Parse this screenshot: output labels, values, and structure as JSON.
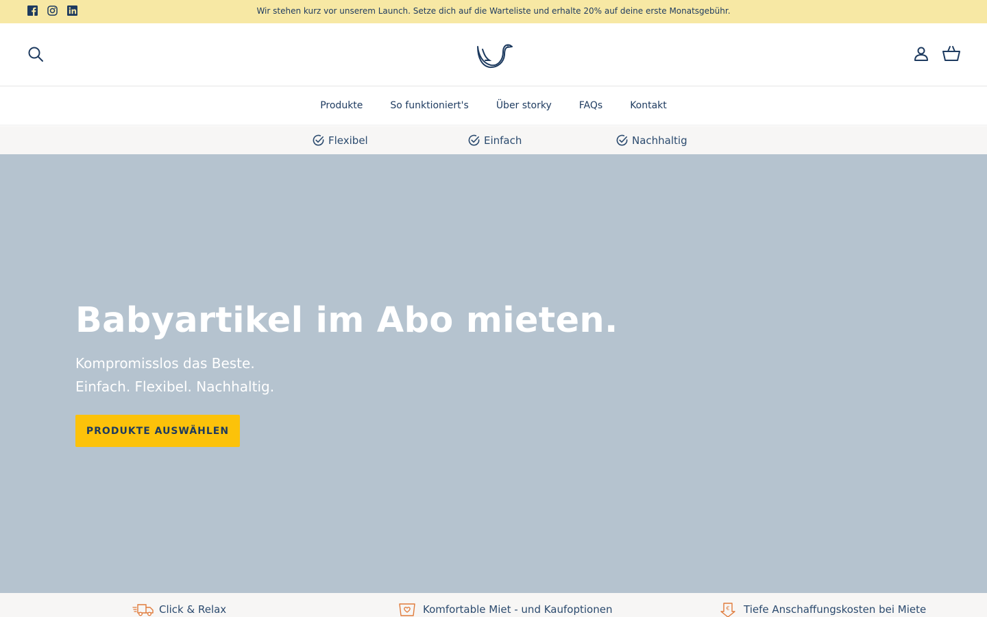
{
  "announcement": {
    "text": "Wir stehen kurz vor unserem Launch. Setze dich auf die Warteliste und erhalte 20% auf deine erste Monatsgebühr.",
    "background": "#f7e8a4",
    "social_icons": [
      "facebook-icon",
      "instagram-icon",
      "linkedin-icon"
    ]
  },
  "header": {
    "icons": [
      "search-icon",
      "logo-stork",
      "account-icon",
      "cart-icon"
    ]
  },
  "nav": {
    "items": [
      {
        "label": "Produkte"
      },
      {
        "label": "So funktioniert's"
      },
      {
        "label": "Über storky"
      },
      {
        "label": "FAQs"
      },
      {
        "label": "Kontakt"
      }
    ]
  },
  "usps": [
    {
      "label": "Flexibel",
      "icon": "check-circle-icon"
    },
    {
      "label": "Einfach",
      "icon": "check-circle-icon"
    },
    {
      "label": "Nachhaltig",
      "icon": "check-circle-icon"
    }
  ],
  "hero": {
    "title": "Babyartikel im Abo mieten.",
    "subtitle_line1": "Kompromisslos das Beste.",
    "subtitle_line2": "Einfach. Flexibel. Nachhaltig.",
    "button_label": "PRODUKTE AUSWÄHLEN",
    "background": "#b5c3cf",
    "button_color": "#fcc20a"
  },
  "benefits": [
    {
      "label": "Click & Relax",
      "icon": "delivery-truck-icon"
    },
    {
      "label": "Komfortable Miet - und Kaufoptionen",
      "icon": "tag-heart-icon"
    },
    {
      "label": "Tiefe Anschaffungskosten bei Miete",
      "icon": "euro-down-icon"
    }
  ],
  "colors": {
    "primary_text": "#1d3a5f",
    "accent_orange": "#e07a3a"
  }
}
